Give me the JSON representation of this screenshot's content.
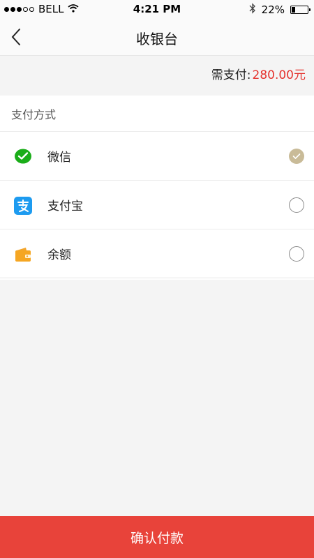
{
  "status_bar": {
    "carrier": "BELL",
    "time": "4:21 PM",
    "battery": "22%",
    "battery_level": 0.22,
    "icons": [
      "signal-dots-icon",
      "wifi-icon",
      "bluetooth-icon",
      "battery-icon"
    ]
  },
  "nav": {
    "title": "收银台",
    "back_icon": "chevron-left-icon"
  },
  "amount": {
    "label": "需支付:",
    "value": "280.00元",
    "value_color": "#e5322d"
  },
  "payment": {
    "section_title": "支付方式",
    "methods": [
      {
        "label": "微信",
        "icon": "wechat-icon",
        "selected": true
      },
      {
        "label": "支付宝",
        "icon": "alipay-icon",
        "selected": false
      },
      {
        "label": "余额",
        "icon": "wallet-icon",
        "selected": false
      }
    ],
    "selected_color": "#c9bb98"
  },
  "confirm_button": {
    "label": "确认付款",
    "color": "#e8433a"
  }
}
